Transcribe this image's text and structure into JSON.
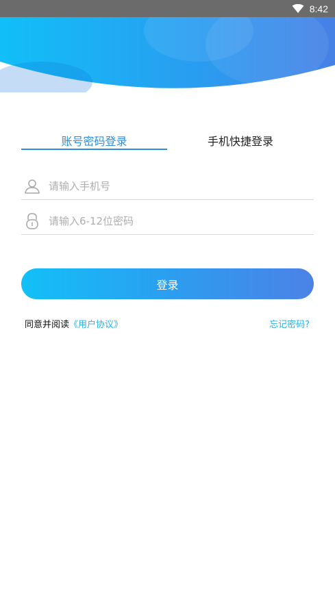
{
  "status_bar": {
    "time": "8:42",
    "icons": [
      "wifi-icon",
      "battery-icon"
    ]
  },
  "tabs": [
    {
      "label": "账号密码登录",
      "active": true
    },
    {
      "label": "手机快捷登录",
      "active": false
    }
  ],
  "form": {
    "phone_placeholder": "请输入手机号",
    "password_placeholder": "请输入6-12位密码",
    "phone_icon": "user-icon",
    "password_icon": "lock-icon"
  },
  "login_button": {
    "label": "登录"
  },
  "agreement": {
    "prefix": "同意并阅读",
    "link": "《用户协议》"
  },
  "forgot_password": "忘记密码?",
  "colors": {
    "accent": "#2b8de0",
    "link": "#2bb1e8",
    "gradient_start": "#12c0f7",
    "gradient_end": "#4c82e6",
    "status_bar": "#6b6b6b"
  }
}
